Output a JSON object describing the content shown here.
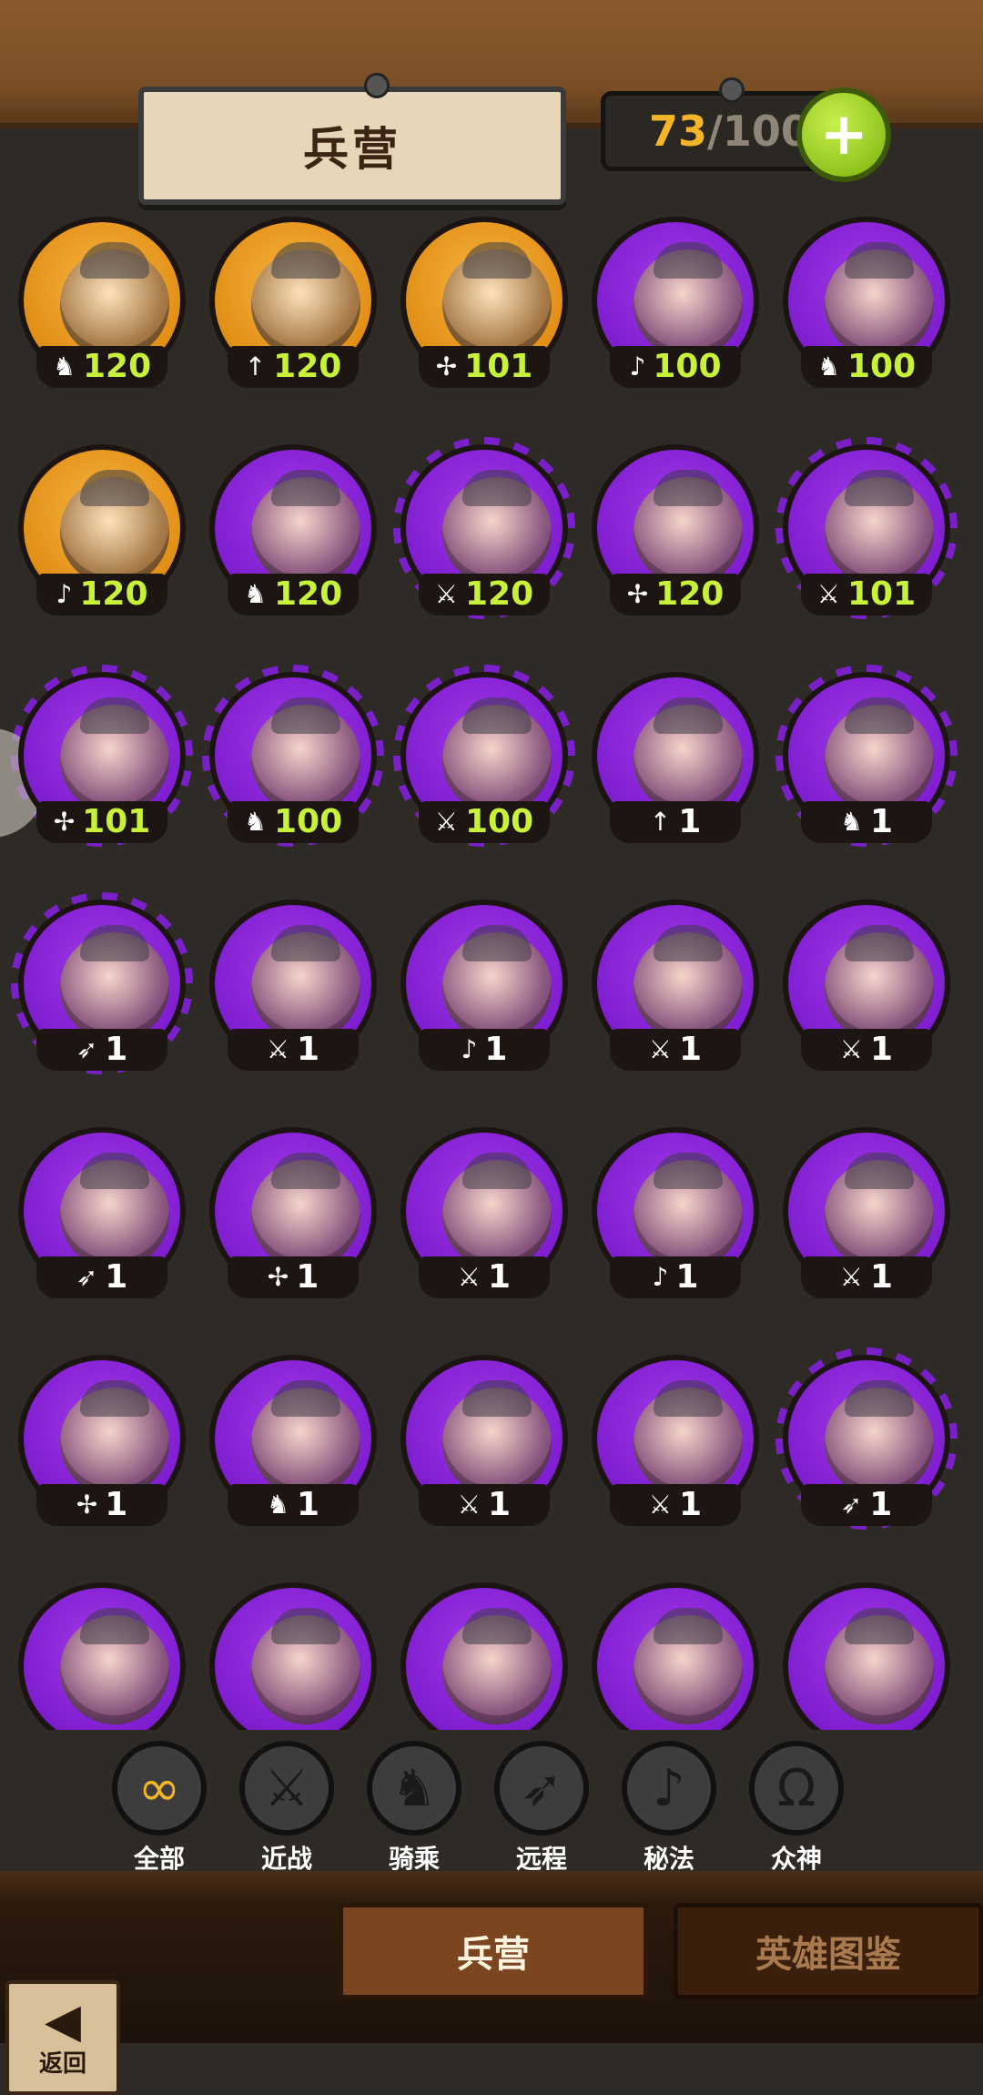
{
  "header": {
    "title": "兵营",
    "count_current": "73",
    "count_separator": "/",
    "count_max": "100",
    "plus_label": "+"
  },
  "units": [
    {
      "level": "120",
      "class_icon": "cavalry-icon",
      "frame": "gold"
    },
    {
      "level": "120",
      "class_icon": "spear-icon",
      "frame": "gold"
    },
    {
      "level": "101",
      "class_icon": "divine-icon",
      "frame": "gold"
    },
    {
      "level": "100",
      "class_icon": "mystic-icon",
      "frame": "purple"
    },
    {
      "level": "100",
      "class_icon": "cavalry-icon",
      "frame": "purple"
    },
    {
      "level": "120",
      "class_icon": "mystic-icon",
      "frame": "gold"
    },
    {
      "level": "120",
      "class_icon": "cavalry-icon",
      "frame": "purple"
    },
    {
      "level": "120",
      "class_icon": "melee-icon",
      "frame": "purple-spiky"
    },
    {
      "level": "120",
      "class_icon": "divine-icon",
      "frame": "purple"
    },
    {
      "level": "101",
      "class_icon": "melee-icon",
      "frame": "purple-spiky"
    },
    {
      "level": "101",
      "class_icon": "divine-icon",
      "frame": "purple-spiky"
    },
    {
      "level": "100",
      "class_icon": "cavalry-icon",
      "frame": "purple-spiky"
    },
    {
      "level": "100",
      "class_icon": "melee-icon",
      "frame": "purple-spiky"
    },
    {
      "level": "1",
      "class_icon": "spear-icon",
      "frame": "purple"
    },
    {
      "level": "1",
      "class_icon": "cavalry-icon",
      "frame": "purple-spiky"
    },
    {
      "level": "1",
      "class_icon": "ranged-icon",
      "frame": "purple-spiky"
    },
    {
      "level": "1",
      "class_icon": "melee-icon",
      "frame": "purple"
    },
    {
      "level": "1",
      "class_icon": "mystic-icon",
      "frame": "purple"
    },
    {
      "level": "1",
      "class_icon": "melee-icon",
      "frame": "purple"
    },
    {
      "level": "1",
      "class_icon": "melee-icon",
      "frame": "purple"
    },
    {
      "level": "1",
      "class_icon": "ranged-icon",
      "frame": "purple"
    },
    {
      "level": "1",
      "class_icon": "divine-icon",
      "frame": "purple"
    },
    {
      "level": "1",
      "class_icon": "melee-icon",
      "frame": "purple"
    },
    {
      "level": "1",
      "class_icon": "mystic-icon",
      "frame": "purple"
    },
    {
      "level": "1",
      "class_icon": "melee-icon",
      "frame": "purple"
    },
    {
      "level": "1",
      "class_icon": "divine-icon",
      "frame": "purple"
    },
    {
      "level": "1",
      "class_icon": "cavalry-icon",
      "frame": "purple"
    },
    {
      "level": "1",
      "class_icon": "melee-icon",
      "frame": "purple"
    },
    {
      "level": "1",
      "class_icon": "melee-icon",
      "frame": "purple"
    },
    {
      "level": "1",
      "class_icon": "ranged-icon",
      "frame": "purple-spiky"
    },
    {
      "level": "",
      "class_icon": "",
      "frame": "purple"
    },
    {
      "level": "",
      "class_icon": "",
      "frame": "purple"
    },
    {
      "level": "",
      "class_icon": "",
      "frame": "purple"
    },
    {
      "level": "",
      "class_icon": "",
      "frame": "purple"
    },
    {
      "level": "",
      "class_icon": "",
      "frame": "purple"
    }
  ],
  "filters": [
    {
      "label": "全部",
      "icon": "infinity-icon",
      "glyph": "∞",
      "active": true
    },
    {
      "label": "近战",
      "icon": "sword-icon",
      "glyph": "⚔",
      "active": false
    },
    {
      "label": "骑乘",
      "icon": "horse-icon",
      "glyph": "♞",
      "active": false
    },
    {
      "label": "远程",
      "icon": "bow-icon",
      "glyph": "➶",
      "active": false
    },
    {
      "label": "秘法",
      "icon": "mystic-icon",
      "glyph": "♪",
      "active": false
    },
    {
      "label": "众神",
      "icon": "omega-icon",
      "glyph": "Ω",
      "active": false
    }
  ],
  "tabs": {
    "barracks": "兵营",
    "codex": "英雄图鉴"
  },
  "back": {
    "label": "返回",
    "glyph": "◀"
  },
  "class_glyphs": {
    "cavalry-icon": "♞",
    "spear-icon": "↑",
    "divine-icon": "✢",
    "mystic-icon": "♪",
    "melee-icon": "⚔",
    "ranged-icon": "➶"
  },
  "colors": {
    "level_high": "#c8f13a",
    "level_low": "#ffffff",
    "accent_gold": "#f3b629"
  }
}
